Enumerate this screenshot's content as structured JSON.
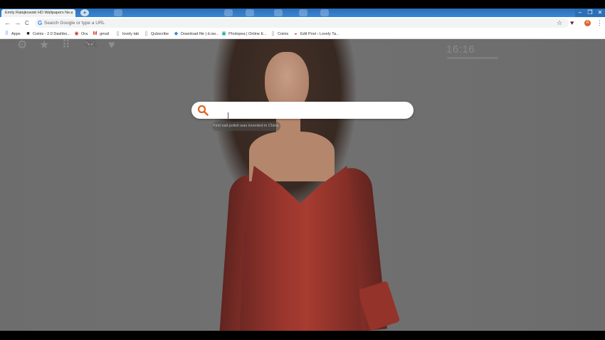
{
  "browser": {
    "tab_title": "Emily Ratajkowski HD Wallpapers Ne...",
    "tab_close": "×",
    "new_tab": "+",
    "window_controls": [
      "–",
      "❐",
      "✕"
    ],
    "nav": {
      "back": "←",
      "forward": "→",
      "reload": "C"
    },
    "address_placeholder": "Search Google or type a URL",
    "google_glyph": "G",
    "star": "☆",
    "extension": "♥",
    "profile_initial": "A",
    "menu": "⋮"
  },
  "bookmarks": [
    {
      "label": "Apps",
      "icon": "apps-grid-icon",
      "glyph": "⠿",
      "color": "#4285f4"
    },
    {
      "label": "Coinis - 2.0 Dashbo...",
      "icon": "coinis-icon",
      "glyph": "■",
      "color": "#222"
    },
    {
      "label": "Ora",
      "icon": "ora-icon",
      "glyph": "◉",
      "color": "#c0392b"
    },
    {
      "label": "gmail",
      "icon": "gmail-icon",
      "glyph": "M",
      "color": "#d93025"
    },
    {
      "label": "lovely tab",
      "icon": "page-icon",
      "glyph": "▯",
      "color": "#777"
    },
    {
      "label": "Qubscribe",
      "icon": "page-icon",
      "glyph": "▯",
      "color": "#777"
    },
    {
      "label": "Download file | d.ow...",
      "icon": "download-icon",
      "glyph": "◆",
      "color": "#3b7dd8"
    },
    {
      "label": "Photopea | Online E...",
      "icon": "photopea-icon",
      "glyph": "▣",
      "color": "#18a497"
    },
    {
      "label": "Coinis",
      "icon": "page-icon",
      "glyph": "▯",
      "color": "#777"
    },
    {
      "label": "Edit Post ‹ Lovely Ta...",
      "icon": "wordpress-icon",
      "glyph": "◒",
      "color": "#c0392b"
    }
  ],
  "ntp": {
    "icons": [
      {
        "name": "settings-gear-icon",
        "glyph": "⚙"
      },
      {
        "name": "favorites-star-icon",
        "glyph": "★"
      },
      {
        "name": "apps-grid-icon",
        "glyph": "⠿"
      },
      {
        "name": "games-gamepad-icon",
        "glyph": "🎮"
      },
      {
        "name": "favorite-heart-icon",
        "glyph": "♥"
      }
    ],
    "clock": "16:16",
    "search_value": "",
    "fact": "First nail polish was invented in China."
  },
  "colors": {
    "search_icon": "#e0642a",
    "tab_strip": "#2a6fb8"
  }
}
